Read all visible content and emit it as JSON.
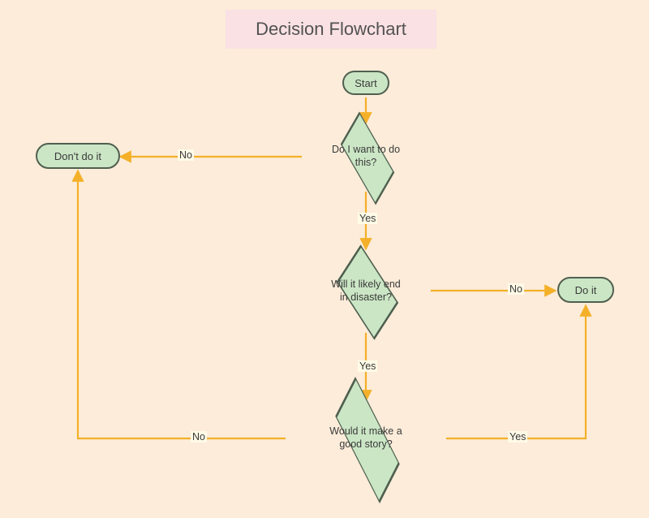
{
  "title": "Decision Flowchart",
  "nodes": {
    "start": {
      "label": "Start"
    },
    "dontdoit": {
      "label": "Don't do it"
    },
    "doit": {
      "label": "Do it"
    },
    "q_want": {
      "label": "Do I want to do this?"
    },
    "q_disaster": {
      "label": "Will it likely end in disaster?"
    },
    "q_story": {
      "label": "Would it make a good story?"
    }
  },
  "edges": {
    "want_no": {
      "label": "No"
    },
    "want_yes": {
      "label": "Yes"
    },
    "disaster_no": {
      "label": "No"
    },
    "disaster_yes": {
      "label": "Yes"
    },
    "story_no": {
      "label": "No"
    },
    "story_yes": {
      "label": "Yes"
    }
  },
  "colors": {
    "background": "#fcecd9",
    "node_fill": "#cbe6c5",
    "node_border": "#4f5f4f",
    "arrow": "#f4b029",
    "title_bg": "#fae1e3"
  }
}
